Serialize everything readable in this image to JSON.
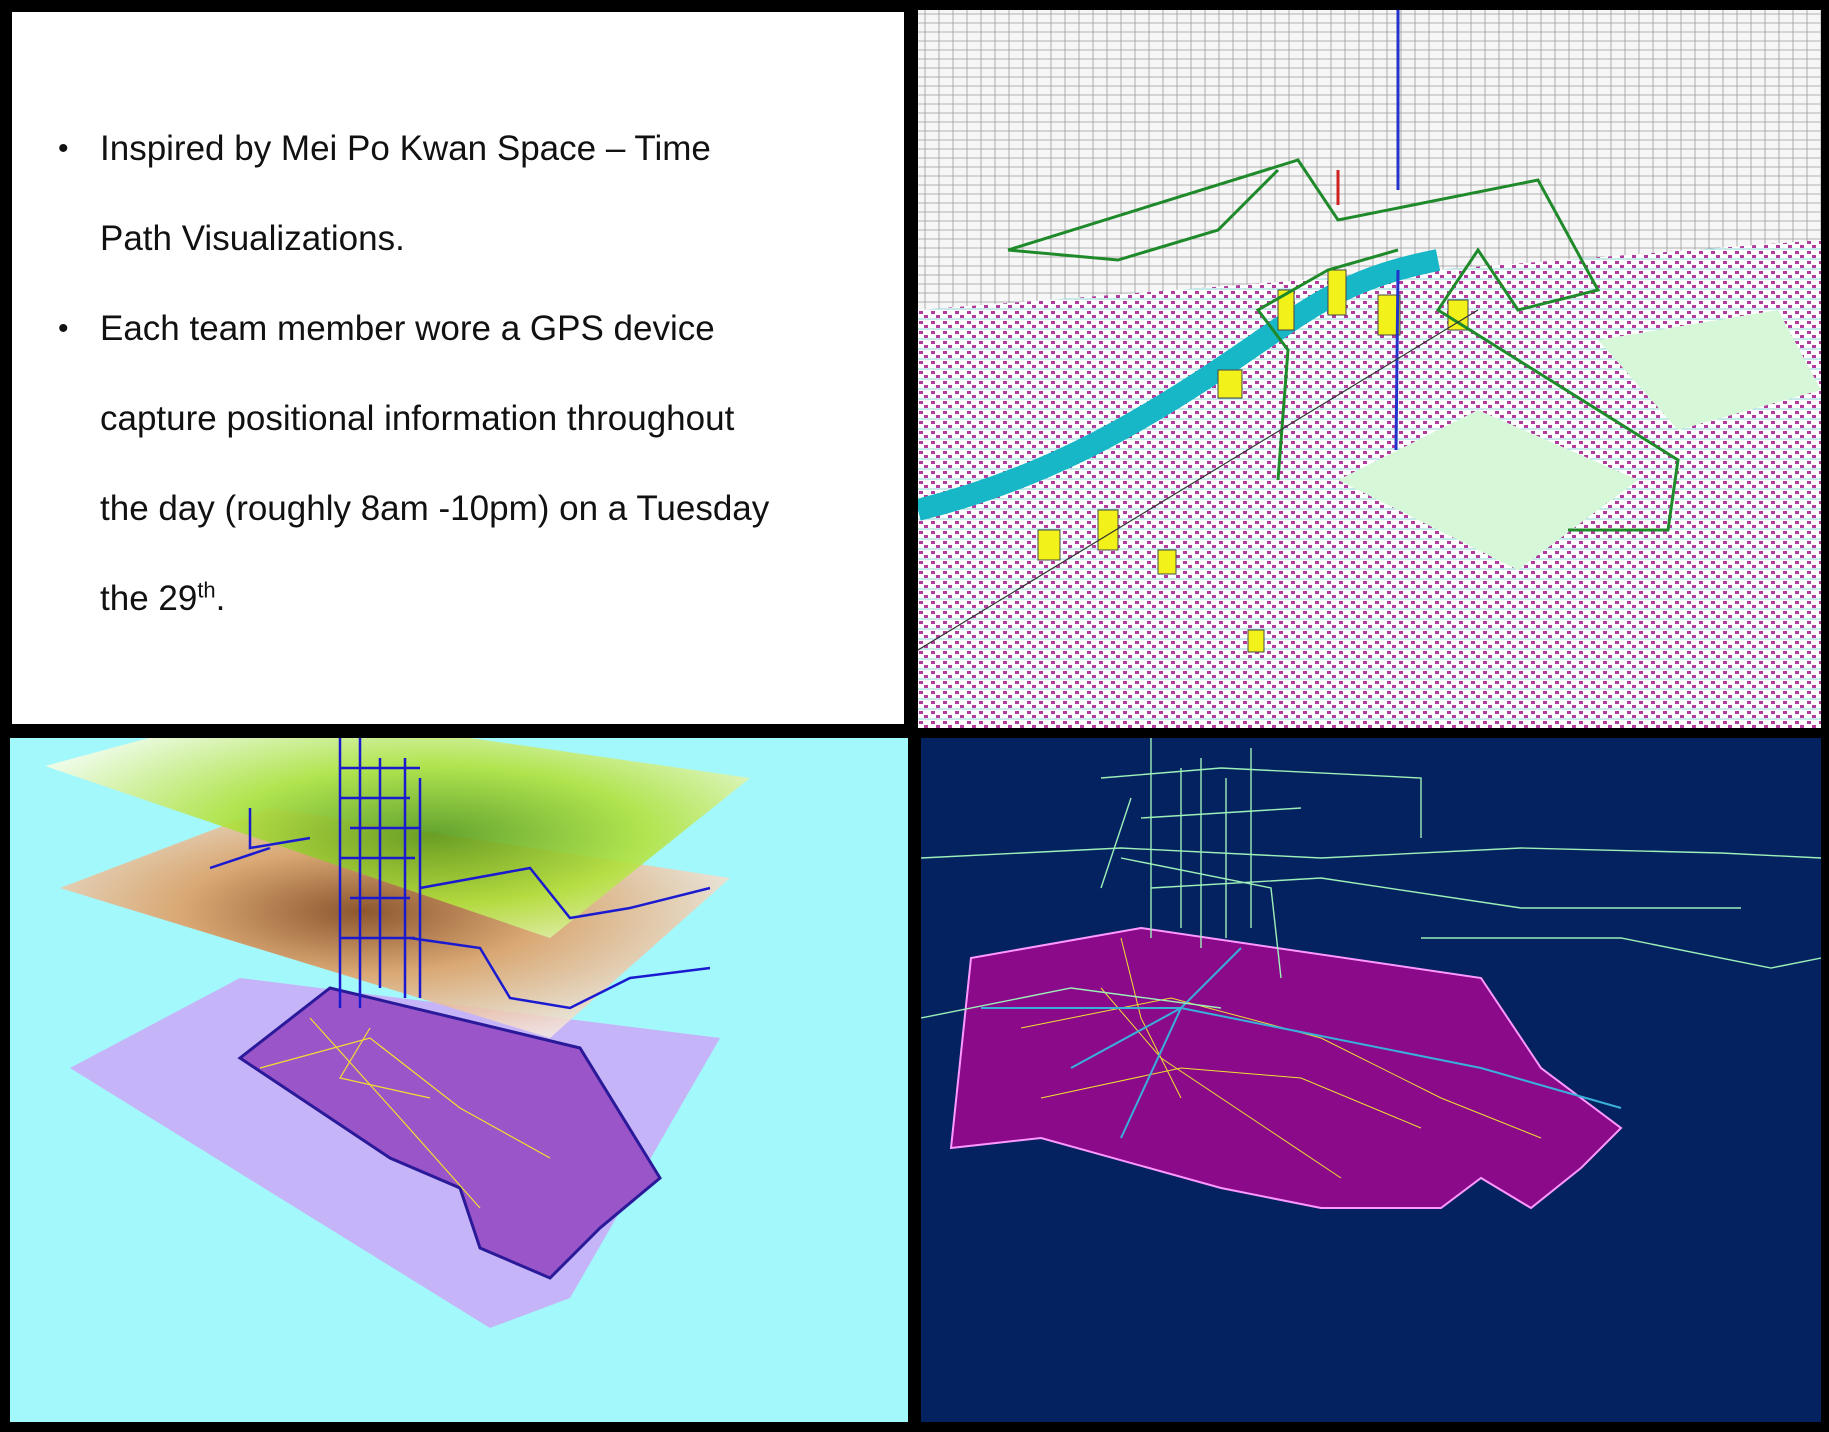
{
  "text_panel": {
    "bullets": [
      {
        "line1": "Inspired by Mei Po Kwan Space – Time",
        "line2": "Path Visualizations."
      }
    ],
    "bullet2": {
      "line1": "Each team member wore a GPS device",
      "line2": "capture positional information throughout",
      "line3": "the day (roughly 8am -10pm) on a Tuesday",
      "line4_prefix": "the 29",
      "line4_sup": "th",
      "line4_suffix": "."
    },
    "bullet_glyph": "•"
  },
  "images": {
    "city_3d": "3D city model with buildings, river and GPS space-time paths",
    "layered_surfaces": "Stacked density surfaces with space-time path over region map",
    "navy_paths": "Space-time paths above magenta region road map on navy background"
  },
  "colors": {
    "frame": "#000000",
    "layer_bg": "#a3f8fb",
    "navy_bg": "#052260",
    "magenta": "#8a0a8a",
    "path_green": "#2a8a2a",
    "path_blue": "#1a1ad0",
    "road_yellow": "#f0e030"
  }
}
